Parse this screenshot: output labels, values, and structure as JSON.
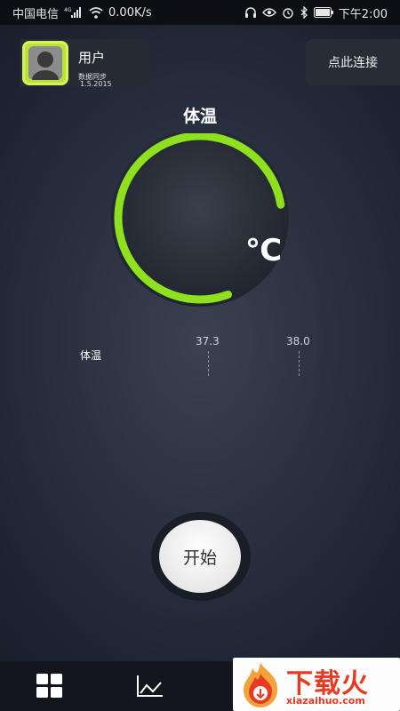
{
  "status_bar": {
    "carrier": "中国电信",
    "signal_label": "4G",
    "speed": "0.00K/s",
    "time": "下午2:00",
    "icons": [
      "headphones-icon",
      "eye-icon",
      "alarm-icon",
      "bluetooth-icon",
      "battery-icon"
    ]
  },
  "header": {
    "user_name": "用户",
    "sync_label": "数据同步",
    "sync_date": "1.5.2015",
    "connect_label": "点此连接"
  },
  "gauge": {
    "title": "体温",
    "unit": "℃",
    "arc_color": "#8fe01e",
    "progress_fraction": 0.78
  },
  "scale": {
    "label": "体温",
    "ticks": [
      "37.3",
      "38.0"
    ]
  },
  "start_button": {
    "label": "开始"
  },
  "bottom_nav": {
    "items": [
      "grid-icon",
      "line-chart-icon"
    ]
  },
  "watermark": {
    "text": "下载火",
    "url": "xiazaihuo.com",
    "color": "#e63a23"
  }
}
